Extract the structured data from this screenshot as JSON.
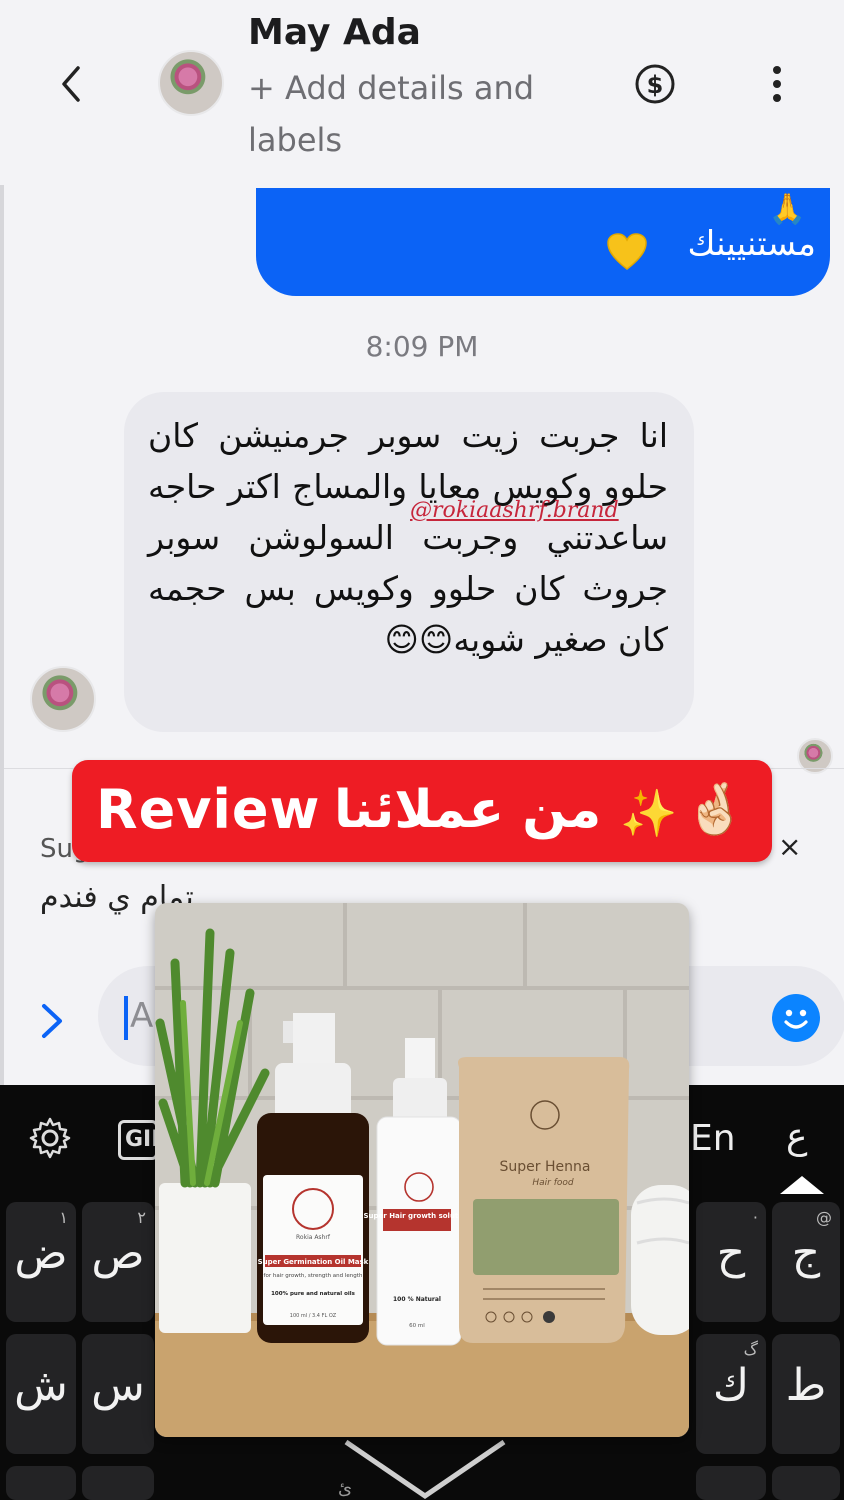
{
  "header": {
    "contact_name": "May Ada",
    "add_details": "+ Add details and labels"
  },
  "messages": {
    "outgoing_text": "مستنيينك",
    "outgoing_emoji": "🙏",
    "timestamp": "8:09 PM",
    "incoming_text": "انا جربت زيت سوبر جرمنيشن كان حلوو وكويس معايا والمساج اكتر حاجه ساعدتني وجربت السولوشن سوبر جروث كان حلوو وكويس بس حجمه كان صغير شويه😊😊",
    "watermark": "@rokiaashrf.brand"
  },
  "suggestion": {
    "label": "Sug",
    "text": "تمام ي فندم",
    "close": "×"
  },
  "banner": {
    "review": "Review",
    "arabic": "من عملائنا",
    "sparkle": "✨",
    "hand": "🤞🏻"
  },
  "compose": {
    "placeholder": "Aa"
  },
  "keyboard": {
    "gif": "GIF",
    "lang_en": "En",
    "lang_ar": "ع",
    "keys": [
      {
        "main": "ض",
        "hint": "١"
      },
      {
        "main": "ص",
        "hint": "٢"
      },
      {
        "main": "ح",
        "hint": "·"
      },
      {
        "main": "ج",
        "hint": "@"
      },
      {
        "main": "ش",
        "hint": ""
      },
      {
        "main": "س",
        "hint": ""
      },
      {
        "main": "ك",
        "hint": "گ"
      },
      {
        "main": "ط",
        "hint": ""
      }
    ],
    "bottom_hint": "ئ"
  },
  "products": {
    "brand": "Rokia Ashrf",
    "oil_name": "Super Germination Oil Mask",
    "oil_sub": "for hair growth, strength and length",
    "oil_pure": "100% pure and natural oils",
    "oil_ml": "100 ml / 3.4 FL OZ",
    "spray_name": "Super Hair growth solution",
    "spray_natural": "100 % Natural",
    "spray_ml": "60 ml",
    "henna_name": "Super Henna",
    "henna_sub": "Hair food"
  },
  "colors": {
    "accent_blue": "#0b63f6",
    "banner_red": "#ee1c24",
    "keyboard_bg": "#0a0a0a"
  }
}
